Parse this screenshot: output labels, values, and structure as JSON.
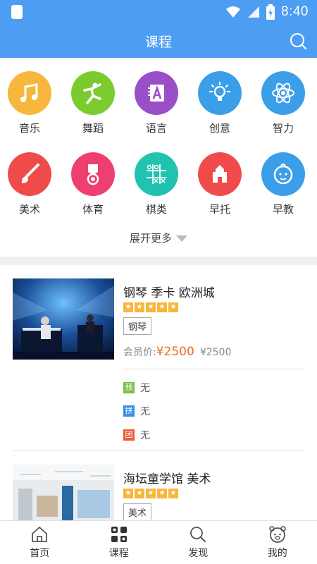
{
  "statusbar": {
    "time": "8:40"
  },
  "header": {
    "title": "课程"
  },
  "categories": [
    {
      "label": "音乐",
      "icon": "music-icon",
      "color": "#f6b73c"
    },
    {
      "label": "舞蹈",
      "icon": "dance-icon",
      "color": "#7ccb2e"
    },
    {
      "label": "语言",
      "icon": "language-icon",
      "color": "#9a4fc9"
    },
    {
      "label": "创意",
      "icon": "lightbulb-icon",
      "color": "#3a9ee8"
    },
    {
      "label": "智力",
      "icon": "atom-icon",
      "color": "#3a9ee8"
    },
    {
      "label": "美术",
      "icon": "paintbrush-icon",
      "color": "#ef4b4b"
    },
    {
      "label": "体育",
      "icon": "medal-icon",
      "color": "#ef3f6f"
    },
    {
      "label": "棋类",
      "icon": "tictactoe-icon",
      "color": "#1fc3b0"
    },
    {
      "label": "早托",
      "icon": "school-icon",
      "color": "#ef4b4b"
    },
    {
      "label": "早教",
      "icon": "baby-face-icon",
      "color": "#3a9ee8"
    }
  ],
  "expand_label": "展开更多",
  "courses": [
    {
      "title": "钢琴 季卡 欧洲城",
      "tag": "钢琴",
      "member_price_label": "会员价:",
      "member_price": "¥2500",
      "original_price": "¥2500",
      "promos": [
        {
          "badge": "预",
          "value": "无",
          "color": "#7ac143"
        },
        {
          "badge": "拼",
          "value": "无",
          "color": "#3a8ee6"
        },
        {
          "badge": "团",
          "value": "无",
          "color": "#ef5a3a"
        }
      ]
    },
    {
      "title": "海坛童学馆 美术",
      "tag": "美术"
    }
  ],
  "bottom_nav": [
    {
      "label": "首页",
      "icon": "home-icon"
    },
    {
      "label": "课程",
      "icon": "courses-grid-icon"
    },
    {
      "label": "发现",
      "icon": "discover-search-icon"
    },
    {
      "label": "我的",
      "icon": "bear-profile-icon"
    }
  ],
  "colors": {
    "primary": "#4d9df2",
    "price": "#f06a1c",
    "star": "#f6b73c"
  }
}
